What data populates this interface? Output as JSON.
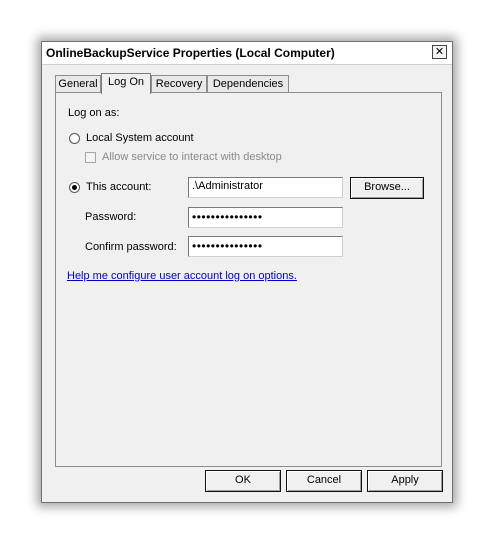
{
  "window": {
    "title": "OnlineBackupService Properties (Local Computer)",
    "close_glyph": "✕"
  },
  "tabs": [
    {
      "label": "General"
    },
    {
      "label": "Log On",
      "active": true
    },
    {
      "label": "Recovery"
    },
    {
      "label": "Dependencies"
    }
  ],
  "logon": {
    "heading": "Log on as:",
    "local_system_label": "Local System account",
    "allow_interact_label": "Allow service to interact with desktop",
    "this_account_label": "This account:",
    "account_value": ".\\Administrator",
    "browse_label": "Browse...",
    "password_label": "Password:",
    "password_value": "•••••••••••••••",
    "confirm_label": "Confirm password:",
    "confirm_value": "•••••••••••••••",
    "help_link": "Help me configure user account log on options.",
    "selected": "this_account"
  },
  "buttons": {
    "ok": "OK",
    "cancel": "Cancel",
    "apply": "Apply"
  },
  "colors": {
    "link": "#0000cc",
    "dialog_bg": "#f0f0f0"
  }
}
